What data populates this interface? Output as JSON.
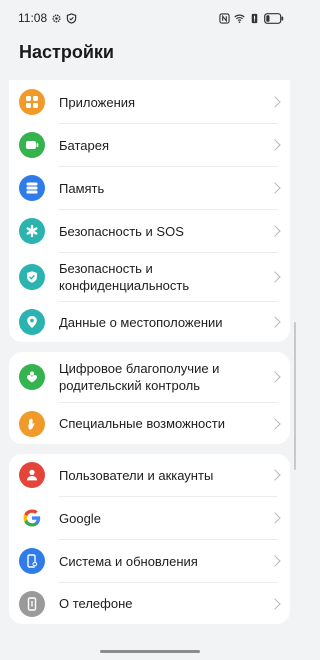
{
  "status_bar": {
    "time": "11:08",
    "left_icons": [
      "settings-gear-icon",
      "shield-icon"
    ],
    "right_icons": [
      "nfc-icon",
      "wifi-icon",
      "battery-alert-icon",
      "battery-icon"
    ],
    "battery_level": 0.25
  },
  "header": {
    "title": "Настройки"
  },
  "groups": [
    {
      "items": [
        {
          "label": "Приложения",
          "icon": "apps-grid-icon",
          "icon_color": "#f09a2a"
        },
        {
          "label": "Батарея",
          "icon": "battery-icon",
          "icon_color": "#34b34f"
        },
        {
          "label": "Память",
          "icon": "storage-icon",
          "icon_color": "#2f7bea"
        },
        {
          "label": "Безопасность и SOS",
          "icon": "asterisk-icon",
          "icon_color": "#2bb3b0"
        },
        {
          "label": "Безопасность и конфиденциальность",
          "icon": "shield-check-icon",
          "icon_color": "#2bb3b0"
        },
        {
          "label": "Данные о местоположении",
          "icon": "location-pin-icon",
          "icon_color": "#2bb3b0"
        }
      ]
    },
    {
      "items": [
        {
          "label": "Цифровое благополучие и родительский контроль",
          "icon": "wellbeing-heart-icon",
          "icon_color": "#34b34f"
        },
        {
          "label": "Специальные возможности",
          "icon": "hand-icon",
          "icon_color": "#f09a2a"
        }
      ]
    },
    {
      "items": [
        {
          "label": "Пользователи и аккаунты",
          "icon": "user-icon",
          "icon_color": "#e4453a"
        },
        {
          "label": "Google",
          "icon": "google-g-icon",
          "icon_color": "#ffffff"
        },
        {
          "label": "Система и обновления",
          "icon": "phone-settings-icon",
          "icon_color": "#2f7bea"
        },
        {
          "label": "О телефоне",
          "icon": "phone-info-icon",
          "icon_color": "#9a9a9a"
        }
      ]
    }
  ]
}
